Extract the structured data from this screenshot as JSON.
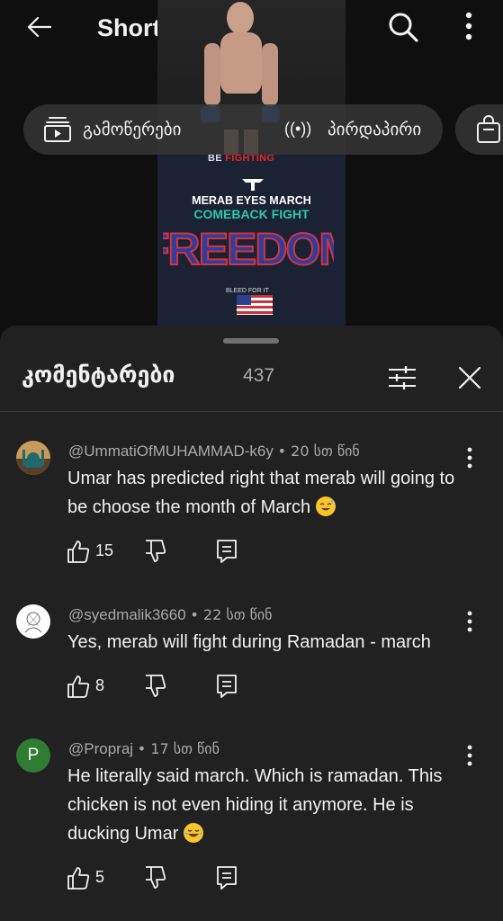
{
  "header": {
    "title": "Shorts",
    "back_icon": "arrow-left-icon",
    "search_icon": "search-icon",
    "more_icon": "more-vertical-icon"
  },
  "video": {
    "overlay_be": "BE",
    "overlay_fighting": "FIGHTING",
    "headline_1": "MERAB EYES MARCH",
    "headline_2": "COMEBACK FIGHT",
    "shirt_text": "FREEDOM",
    "shirt_small": "BLEED FOR IT"
  },
  "chips": {
    "subscriptions_label": "გამოწერები",
    "live_label": "პირდაპირი",
    "shopping_icon": "shopping-bag-icon"
  },
  "comments_panel": {
    "title": "კომენტარები",
    "count": "437",
    "filter_icon": "sliders-icon",
    "close_icon": "close-icon"
  },
  "comments": [
    {
      "author": "@UmmatiOfMUHAMMAD-k6y",
      "time": "• 20 სთ წინ",
      "text": "Umar has predicted right that merab will going to be choose the month of March",
      "emoji": "sweat-smile-emoji",
      "likes": "15",
      "avatar": "mosque-avatar"
    },
    {
      "author": "@syedmalik3660",
      "time": "• 22 სთ წინ",
      "text": "Yes, merab will fight during Ramadan - march",
      "likes": "8",
      "avatar": "sketch-avatar"
    },
    {
      "author": "@Propraj",
      "time": "• 17 სთ წინ",
      "text": "He literally said march. Which is ramadan. This chicken is not even hiding it anymore. He is ducking Umar",
      "emoji": "tears-of-joy-emoji",
      "likes": "5",
      "avatar_letter": "P",
      "avatar_color": "#2e7d32"
    }
  ],
  "colors": {
    "background": "#0f0f0f",
    "sheet": "#212121",
    "secondary_text": "#aaaaaa",
    "comeback_green": "#27c9a3",
    "fighting_red": "#e52424"
  }
}
